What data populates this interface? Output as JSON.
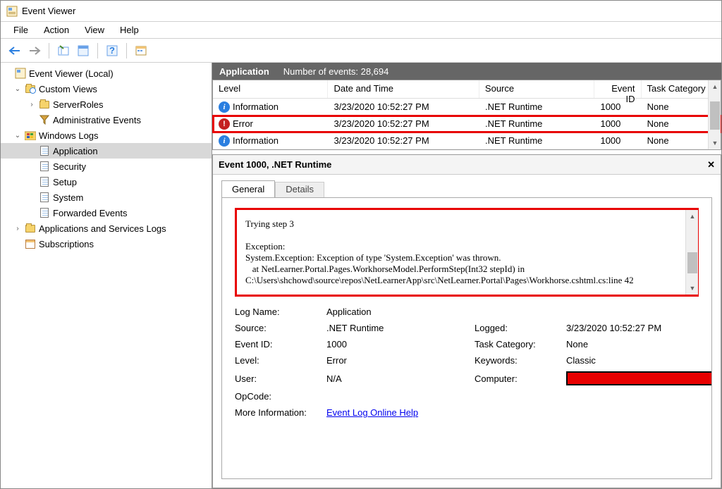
{
  "window_title": "Event Viewer",
  "menus": [
    "File",
    "Action",
    "View",
    "Help"
  ],
  "tree": {
    "root": "Event Viewer (Local)",
    "custom_views": "Custom Views",
    "server_roles": "ServerRoles",
    "admin_events": "Administrative Events",
    "windows_logs": "Windows Logs",
    "application": "Application",
    "security": "Security",
    "setup": "Setup",
    "system": "System",
    "forwarded": "Forwarded Events",
    "app_services": "Applications and Services Logs",
    "subscriptions": "Subscriptions"
  },
  "list_panel": {
    "title": "Application",
    "count_label": "Number of events: 28,694",
    "columns": {
      "level": "Level",
      "date": "Date and Time",
      "source": "Source",
      "eventid": "Event ID",
      "task": "Task Category"
    },
    "rows": [
      {
        "level": "Information",
        "date": "3/23/2020 10:52:27 PM",
        "source": ".NET Runtime",
        "eventid": "1000",
        "task": "None",
        "icon": "info"
      },
      {
        "level": "Error",
        "date": "3/23/2020 10:52:27 PM",
        "source": ".NET Runtime",
        "eventid": "1000",
        "task": "None",
        "icon": "error",
        "highlight": true
      },
      {
        "level": "Information",
        "date": "3/23/2020 10:52:27 PM",
        "source": ".NET Runtime",
        "eventid": "1000",
        "task": "None",
        "icon": "info"
      }
    ]
  },
  "details": {
    "header": "Event 1000, .NET Runtime",
    "tabs": {
      "general": "General",
      "details": "Details"
    },
    "message": "Trying step 3\n\nException:\nSystem.Exception: Exception of type 'System.Exception' was thrown.\n   at NetLearner.Portal.Pages.WorkhorseModel.PerformStep(Int32 stepId) in C:\\Users\\shchowd\\source\\repos\\NetLearnerApp\\src\\NetLearner.Portal\\Pages\\Workhorse.cshtml.cs:line 42",
    "props": {
      "logname_l": "Log Name:",
      "logname_v": "Application",
      "source_l": "Source:",
      "source_v": ".NET Runtime",
      "logged_l": "Logged:",
      "logged_v": "3/23/2020 10:52:27 PM",
      "eventid_l": "Event ID:",
      "eventid_v": "1000",
      "taskcat_l": "Task Category:",
      "taskcat_v": "None",
      "level_l": "Level:",
      "level_v": "Error",
      "keywords_l": "Keywords:",
      "keywords_v": "Classic",
      "user_l": "User:",
      "user_v": "N/A",
      "computer_l": "Computer:",
      "opcode_l": "OpCode:",
      "moreinfo_l": "More Information:",
      "moreinfo_link": "Event Log Online Help"
    }
  }
}
